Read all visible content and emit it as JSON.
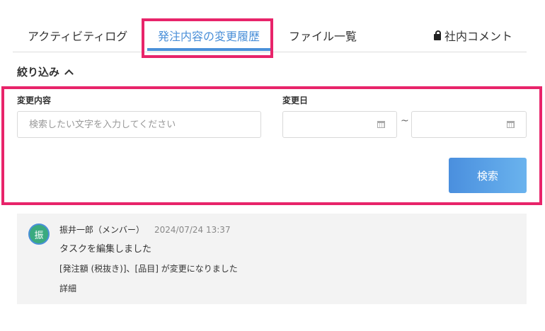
{
  "tabs": [
    {
      "label": "アクティビティログ"
    },
    {
      "label": "発注内容の変更履歴"
    },
    {
      "label": "ファイル一覧"
    },
    {
      "label": "社内コメント"
    }
  ],
  "active_tab": "発注内容の変更履歴",
  "filter": {
    "toggle_label": "絞り込み",
    "content_label": "変更内容",
    "content_placeholder": "検索したい文字を入力してください",
    "date_label": "変更日",
    "date_from": "",
    "date_to": "",
    "range_separator": "~",
    "search_button": "検索"
  },
  "activity": {
    "avatar_char": "振",
    "user": "振井一郎（メンバー）",
    "timestamp": "2024/07/24 13:37",
    "title": "タスクを編集しました",
    "detail": "[発注額 (税抜き)]、[品目] が変更になりました",
    "detail_link": "詳細"
  },
  "colors": {
    "accent": "#4a90d9",
    "highlight": "#e8246a",
    "button_start": "#4a8fde",
    "button_end": "#6ab3ee",
    "avatar_bg": "#3aaa7f"
  },
  "icons": [
    "chevron-up-icon",
    "lock-icon",
    "calendar-icon"
  ]
}
